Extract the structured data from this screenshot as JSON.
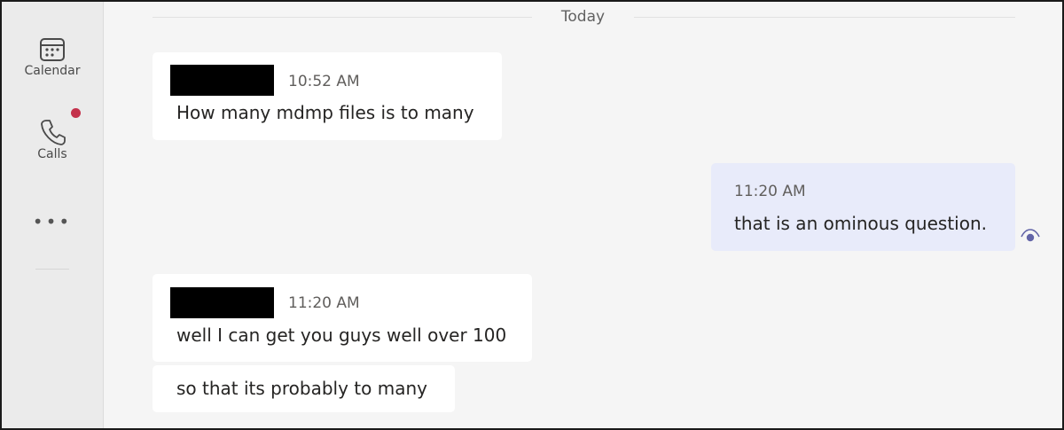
{
  "rail": {
    "items": [
      {
        "label": "Calendar",
        "icon": "calendar-icon"
      },
      {
        "label": "Calls",
        "icon": "phone-icon"
      }
    ],
    "more_label": "•••"
  },
  "chat": {
    "day_separator": "Today",
    "messages": [
      {
        "sender": "redacted",
        "time": "10:52 AM",
        "text": "How many mdmp files is to many"
      },
      {
        "sender": "me",
        "time": "11:20 AM",
        "text": "that is an ominous question."
      },
      {
        "sender": "redacted",
        "time": "11:20 AM",
        "text": "well I can get you guys well over 100"
      },
      {
        "sender": "redacted",
        "time": "",
        "text": "so that its probably to many"
      }
    ]
  },
  "colors": {
    "accent": "#6264a7",
    "badge": "#c4314b",
    "my_bubble": "#e8ebfa",
    "their_bubble": "#ffffff"
  }
}
